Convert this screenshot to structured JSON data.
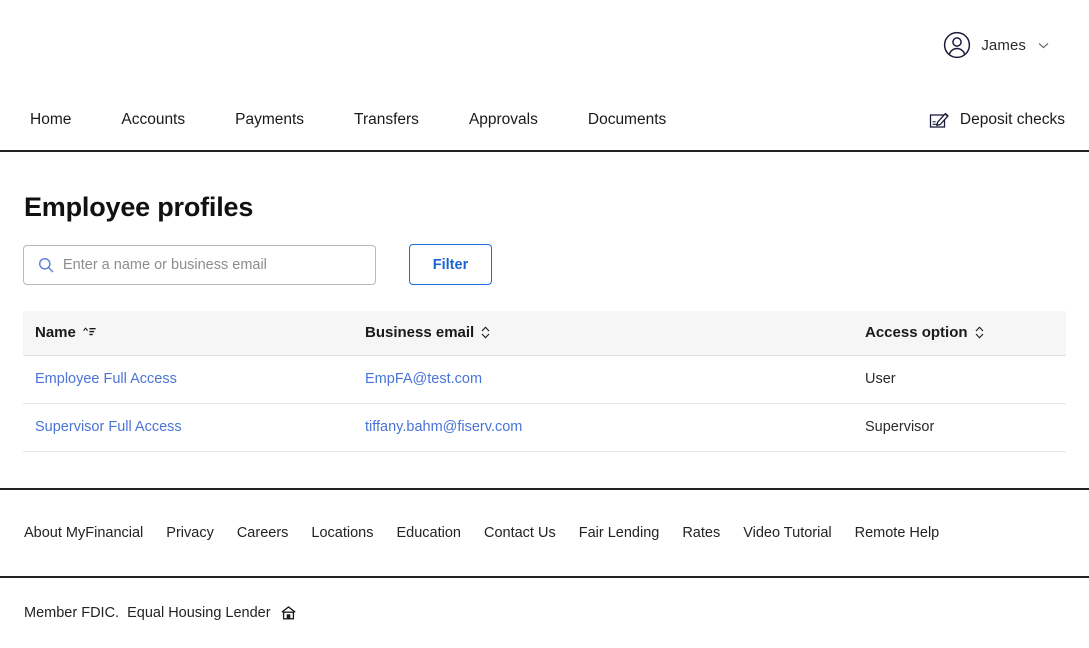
{
  "header": {
    "account": {
      "avatar_icon": "user-avatar-icon",
      "name": "James",
      "chevron_icon": "chevron-down-icon"
    }
  },
  "nav": {
    "items": [
      {
        "label": "Home"
      },
      {
        "label": "Accounts"
      },
      {
        "label": "Payments"
      },
      {
        "label": "Transfers"
      },
      {
        "label": "Approvals"
      },
      {
        "label": "Documents"
      }
    ],
    "action": {
      "icon": "deposit-check-icon",
      "label": "Deposit checks"
    }
  },
  "main": {
    "title": "Employee profiles",
    "search": {
      "icon": "search-icon",
      "placeholder": "Enter a name or business email",
      "value": ""
    },
    "filter_label": "Filter",
    "table": {
      "columns": [
        {
          "label": "Name",
          "sort_icon": "sort-ascending-icon",
          "sort_state": "ascending"
        },
        {
          "label": "Business email",
          "sort_icon": "sort-unsorted-icon",
          "sort_state": "none"
        },
        {
          "label": "Access option",
          "sort_icon": "sort-unsorted-icon",
          "sort_state": "none"
        }
      ],
      "rows": [
        {
          "name": "Employee Full Access",
          "email": "EmpFA@test.com",
          "access": "User"
        },
        {
          "name": "Supervisor Full Access",
          "email": "tiffany.bahm@fiserv.com",
          "access": "Supervisor"
        }
      ]
    }
  },
  "footer": {
    "links": [
      {
        "label": "About MyFinancial"
      },
      {
        "label": "Privacy"
      },
      {
        "label": "Careers"
      },
      {
        "label": "Locations"
      },
      {
        "label": "Education"
      },
      {
        "label": "Contact Us"
      },
      {
        "label": "Fair Lending"
      },
      {
        "label": "Rates"
      },
      {
        "label": "Video Tutorial"
      },
      {
        "label": "Remote Help"
      }
    ],
    "legal": {
      "member_text": "Member FDIC.",
      "lender_text": "Equal Housing Lender",
      "lender_icon": "equal-housing-lender-icon"
    }
  },
  "colors": {
    "link": "#4a74d6",
    "accent": "#1c6ce0",
    "header_row_bg": "#f6f6f6",
    "rule": "#222222"
  }
}
